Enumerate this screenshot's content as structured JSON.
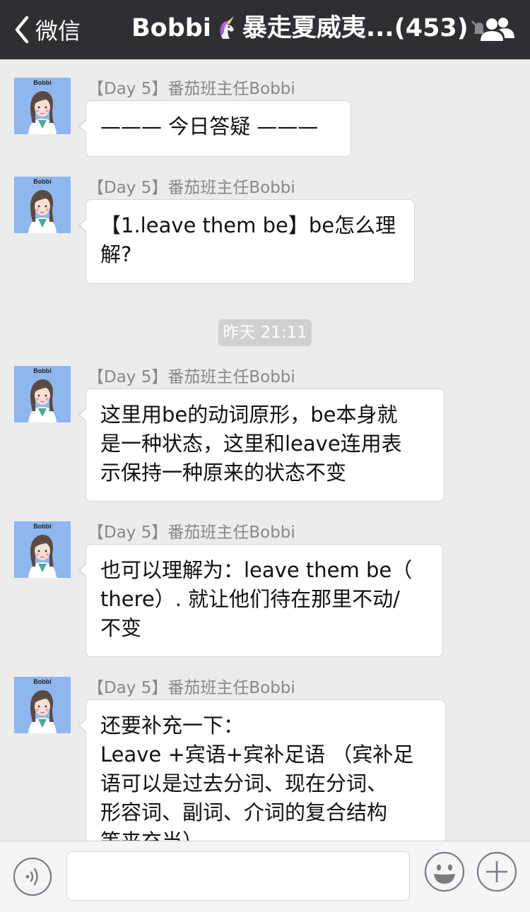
{
  "header": {
    "back_label": "微信",
    "title_prefix": "Bobbi",
    "title_suffix": "暴走夏威夷...(453)"
  },
  "chat": {
    "timestamp": "昨天 21:11",
    "messages": [
      {
        "avatar_name": "Bobbi",
        "sender": "【Day 5】番茄班主任Bobbi",
        "text": "——— 今日答疑 ———"
      },
      {
        "avatar_name": "Bobbi",
        "sender": "【Day 5】番茄班主任Bobbi",
        "text": "【1.leave them be】be怎么理\n解?"
      },
      {
        "avatar_name": "Bobbi",
        "sender": "【Day 5】番茄班主任Bobbi",
        "text": "这里用be的动词原形，be本身就\n是一种状态，这里和leave连用表\n示保持一种原来的状态不变"
      },
      {
        "avatar_name": "Bobbi",
        "sender": "【Day 5】番茄班主任Bobbi",
        "text": "也可以理解为：leave them be（\nthere）. 就让他们待在那里不动/\n不变"
      },
      {
        "avatar_name": "Bobbi",
        "sender": "【Day 5】番茄班主任Bobbi",
        "text": "还要补充一下：\nLeave +宾语+宾补足语 （宾补足\n语可以是过去分词、现在分词、\n形容词、副词、介词的复合结构\n等来充当）"
      }
    ]
  },
  "input": {
    "value": ""
  }
}
